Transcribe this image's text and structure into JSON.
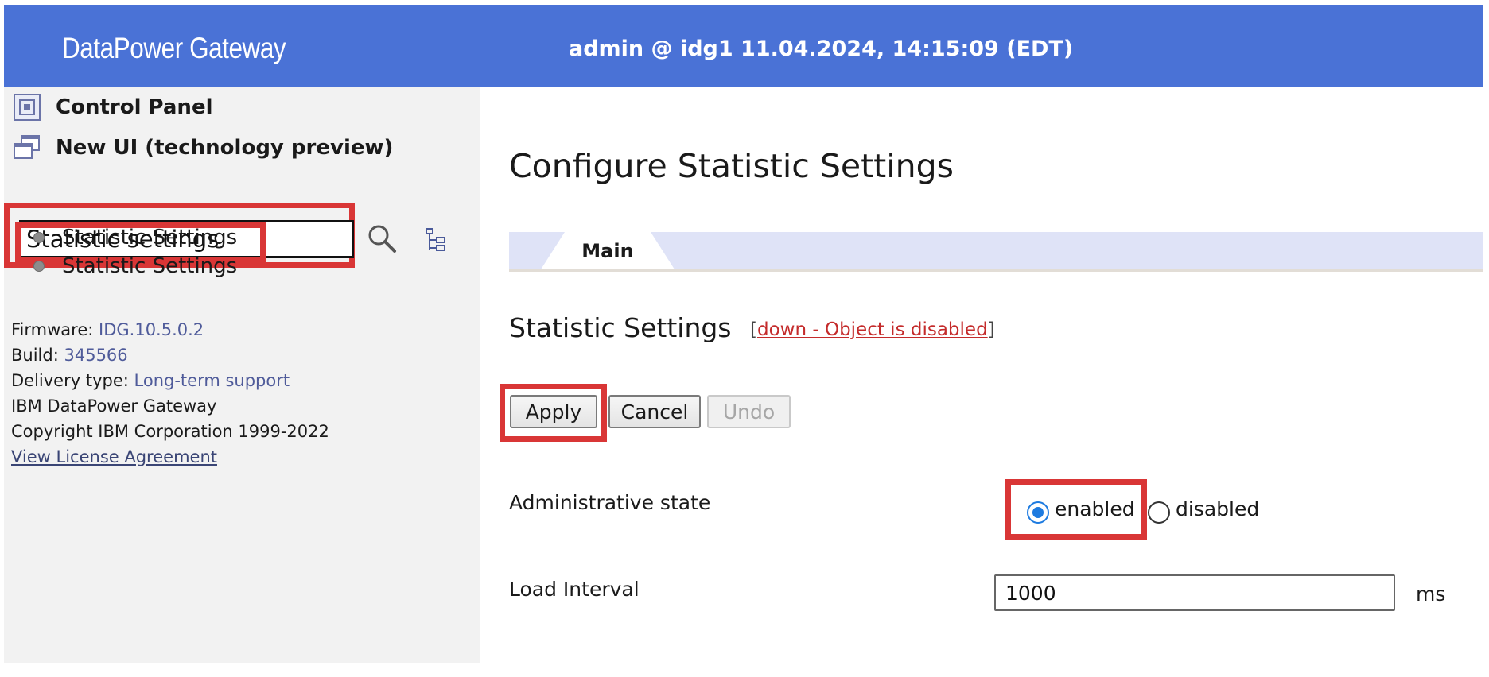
{
  "header": {
    "brand": "DataPower Gateway",
    "session": "admin @ idg1 11.04.2024, 14:15:09 (EDT)"
  },
  "sidebar": {
    "nav": [
      {
        "label": "Control Panel",
        "icon": "control-panel-icon"
      },
      {
        "label": "New UI (technology preview)",
        "icon": "new-ui-icon"
      }
    ],
    "search": {
      "value": "Statistic settings",
      "search_icon": "search-icon",
      "tree_icon": "tree-view-icon"
    },
    "results": [
      {
        "label": "Statistic Settings"
      },
      {
        "label": "Statistic Settings"
      }
    ],
    "info": {
      "firmware_label": "Firmware:",
      "firmware_value": "IDG.10.5.0.2",
      "build_label": "Build:",
      "build_value": "345566",
      "delivery_label": "Delivery type:",
      "delivery_value": "Long-term support",
      "product": "IBM DataPower Gateway",
      "copyright": "Copyright IBM Corporation 1999-2022",
      "license_link": "View License Agreement"
    }
  },
  "main": {
    "title": "Configure Statistic Settings",
    "tabs": [
      {
        "label": "Main",
        "active": true
      }
    ],
    "section_title": "Statistic Settings",
    "status": {
      "open": "[",
      "text": "down - Object is disabled",
      "close": "]"
    },
    "buttons": {
      "apply": "Apply",
      "cancel": "Cancel",
      "undo": "Undo"
    },
    "fields": {
      "admin_state": {
        "label": "Administrative state",
        "options": [
          "enabled",
          "disabled"
        ],
        "selected": "enabled"
      },
      "load_interval": {
        "label": "Load Interval",
        "value": "1000",
        "unit": "ms"
      }
    }
  },
  "colors": {
    "header_bg": "#4a72d6",
    "highlight": "#d93636",
    "tab_bar": "#dfe3f7",
    "status_link": "#c42b2b",
    "radio_selected": "#1e7be0"
  }
}
